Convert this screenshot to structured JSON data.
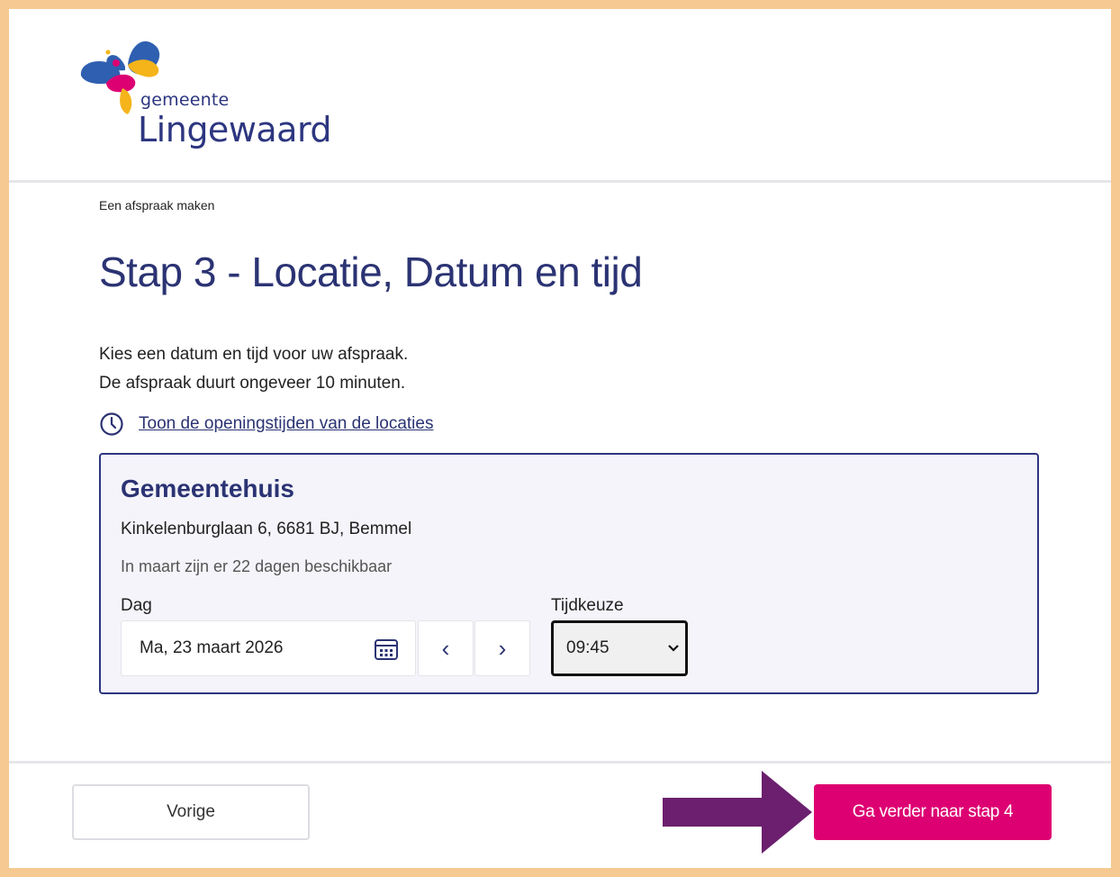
{
  "logo": {
    "small": "gemeente",
    "big": "Lingewaard"
  },
  "breadcrumb": "Een afspraak maken",
  "page_title": "Stap 3 - Locatie, Datum en tijd",
  "intro": {
    "line1": "Kies een datum en tijd voor uw afspraak.",
    "line2": "De afspraak duurt ongeveer 10 minuten."
  },
  "hours_link": {
    "icon": "clock-icon",
    "label": "Toon de openingstijden van de locaties"
  },
  "location": {
    "name": "Gemeentehuis",
    "address": "Kinkelenburglaan 6, 6681 BJ, Bemmel",
    "availability": "In maart zijn er 22 dagen beschikbaar",
    "day_label": "Dag",
    "day_value": "Ma, 23 maart 2026",
    "prev_symbol": "‹",
    "next_symbol": "›",
    "time_label": "Tijdkeuze",
    "time_value": "09:45"
  },
  "footer": {
    "prev_label": "Vorige",
    "next_label": "Ga verder naar stap 4"
  },
  "colors": {
    "primary": "#2b3373",
    "accent": "#dd0072",
    "annotation_arrow": "#6b1f6e",
    "page_border": "#f6c992"
  }
}
